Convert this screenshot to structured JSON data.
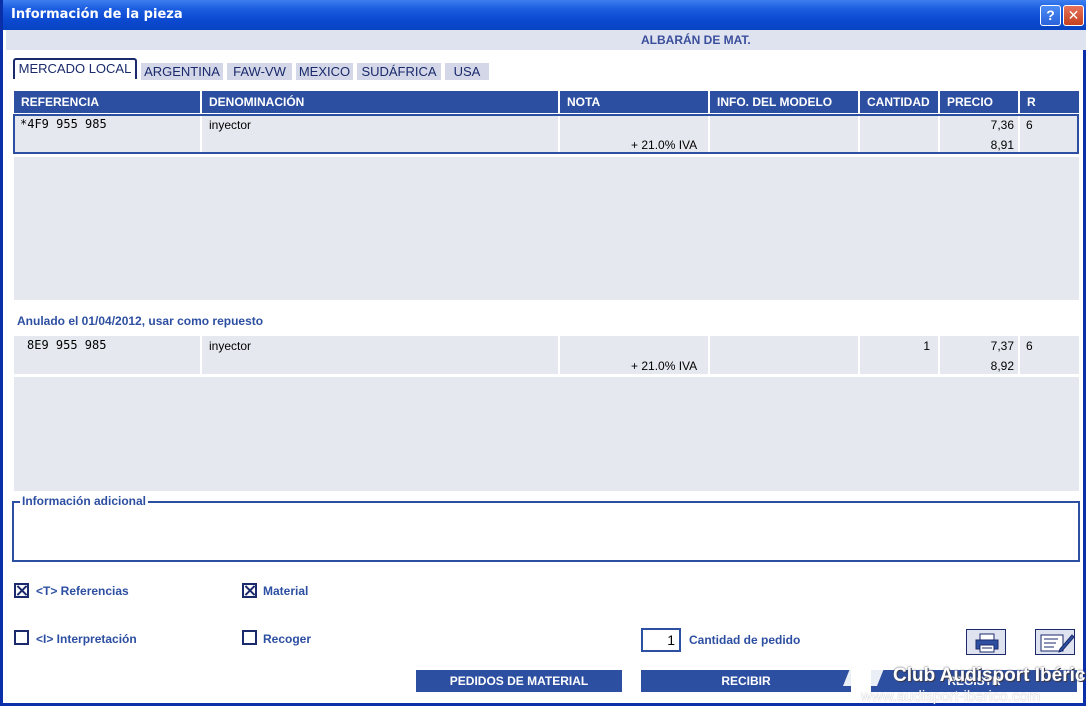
{
  "window": {
    "title": "Información de la pieza",
    "help": "?",
    "close": "✕"
  },
  "header_band": {
    "albaran": "ALBARÁN DE MAT."
  },
  "tabs": [
    {
      "label": "MERCADO LOCAL",
      "active": true
    },
    {
      "label": "ARGENTINA"
    },
    {
      "label": "FAW-VW"
    },
    {
      "label": "MEXICO"
    },
    {
      "label": "SUDÁFRICA"
    },
    {
      "label": "USA"
    }
  ],
  "table": {
    "columns": [
      "REFERENCIA",
      "DENOMINACIÓN",
      "NOTA",
      "INFO. DEL MODELO",
      "CANTIDAD",
      "PRECIO",
      "R"
    ],
    "rows": [
      {
        "referencia": "*4F9 955 985",
        "denominacion": "inyector",
        "nota": "+ 21.0% IVA",
        "info": "",
        "cantidad": "",
        "precio": "7,36",
        "precio_iva": "8,91",
        "r": "6"
      }
    ]
  },
  "replacement": {
    "note": "Anulado el 01/04/2012, usar como repuesto",
    "rows": [
      {
        "referencia": "8E9 955 985",
        "denominacion": "inyector",
        "nota": "+ 21.0% IVA",
        "info": "",
        "cantidad": "1",
        "precio": "7,37",
        "precio_iva": "8,92",
        "r": "6"
      }
    ]
  },
  "info_adicional": {
    "legend": "Información adicional"
  },
  "options": {
    "referencias": {
      "label": "<T> Referencias",
      "checked": true
    },
    "material": {
      "label": "Material",
      "checked": true
    },
    "interpretacion": {
      "label": "<I> Interpretación",
      "checked": false
    },
    "recoger": {
      "label": "Recoger",
      "checked": false
    }
  },
  "order": {
    "quantity": "1",
    "label": "Cantidad de pedido"
  },
  "buttons": {
    "pedidos": "PEDIDOS DE MATERIAL",
    "recibir": "RECIBIR",
    "third": "REGISTR"
  },
  "watermark": {
    "title": "Club Audisport Ibérico",
    "subtitle": "www.audisport-iberico.com"
  }
}
